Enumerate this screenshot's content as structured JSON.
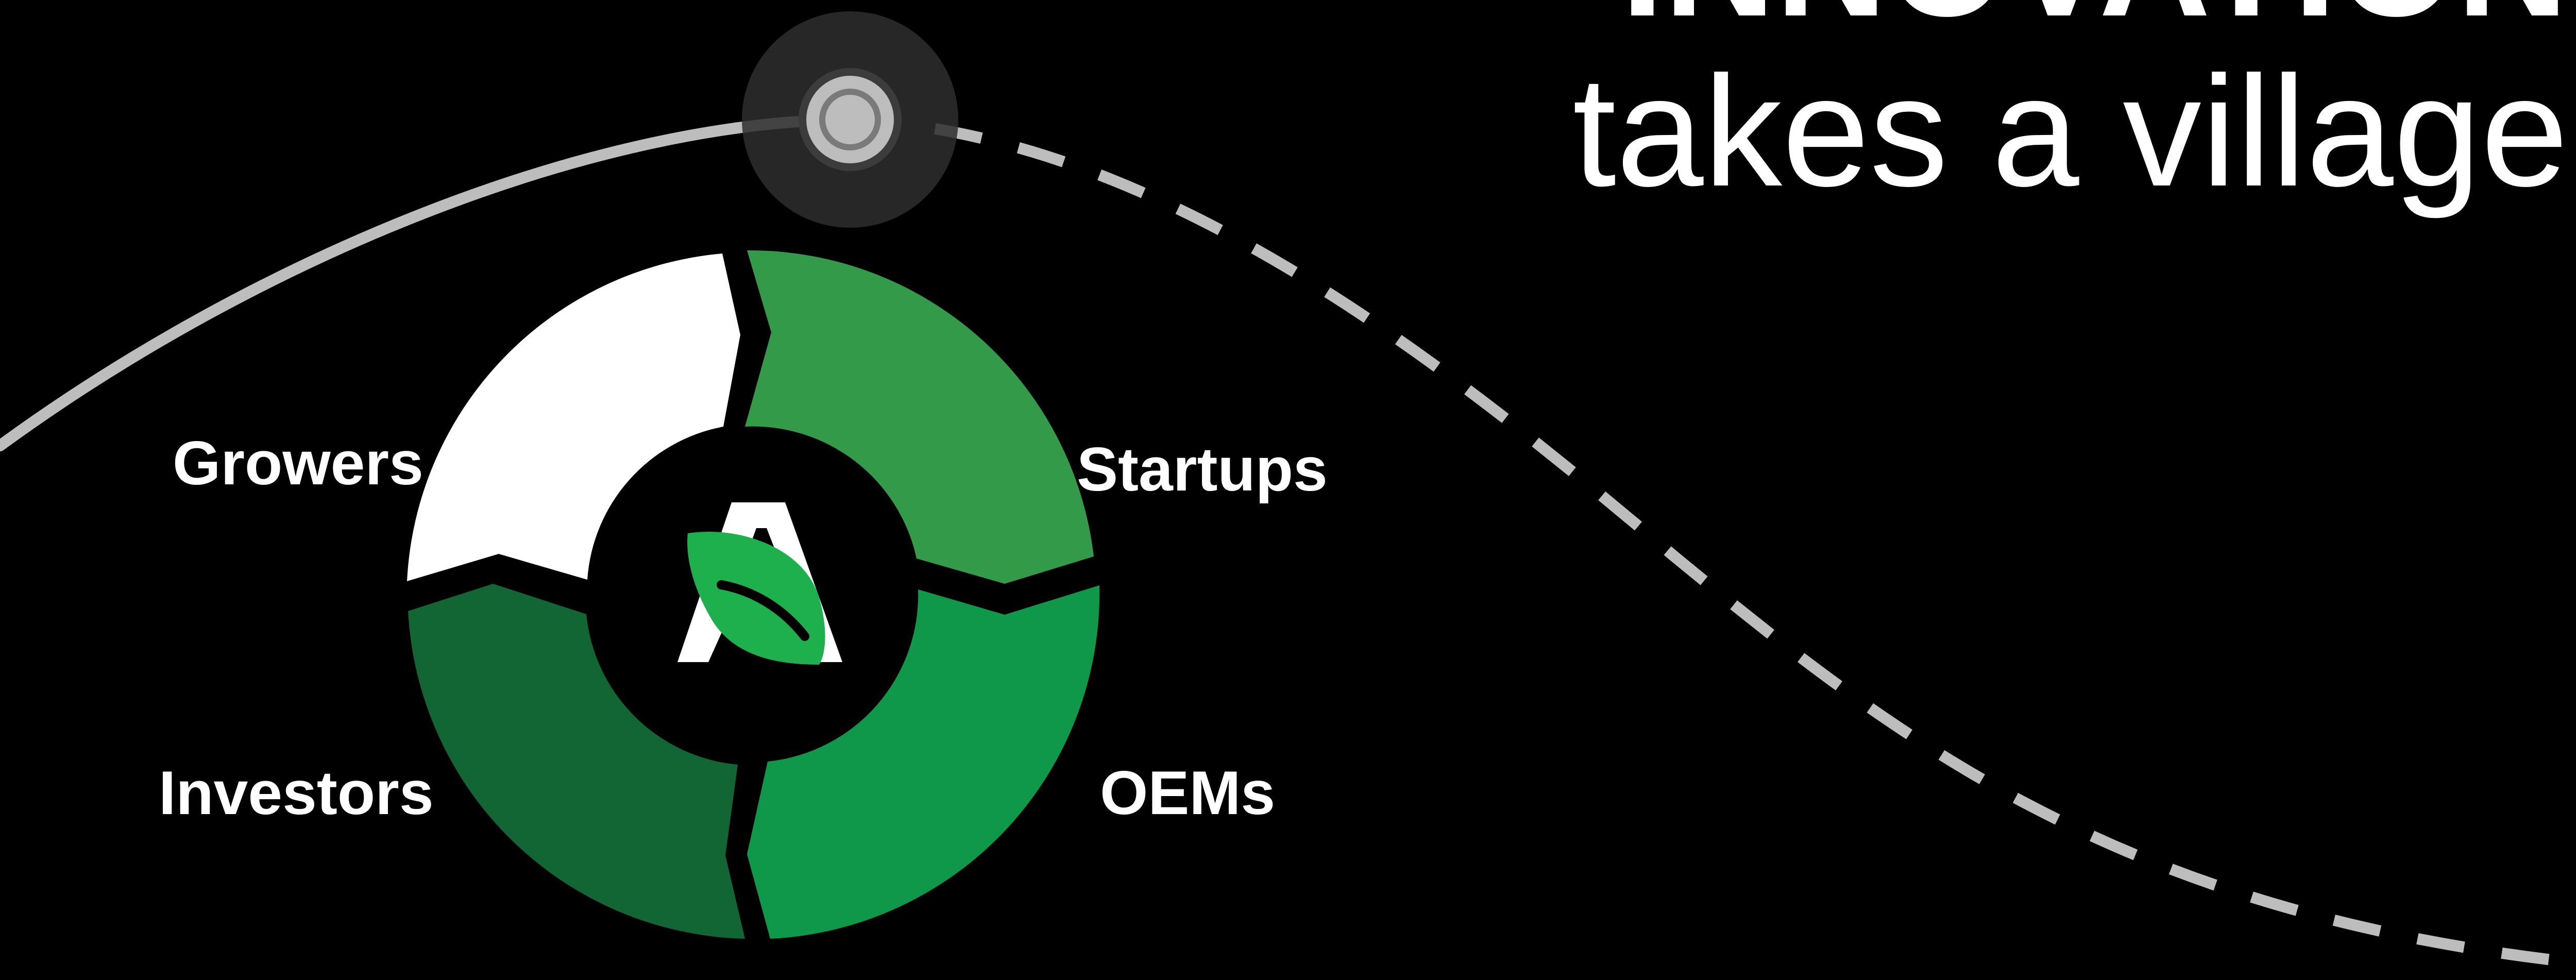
{
  "headline": {
    "main": "INNOVATION",
    "sub": "takes a village"
  },
  "wheel": {
    "segments": [
      {
        "id": "growers",
        "label": "Growers",
        "color": "#FFFFFF"
      },
      {
        "id": "startups",
        "label": "Startups",
        "color": "#339A49"
      },
      {
        "id": "oems",
        "label": "OEMs",
        "color": "#0F9849"
      },
      {
        "id": "investors",
        "label": "Investors",
        "color": "#116633"
      }
    ],
    "center_logo": {
      "letter": "A",
      "leaf_color": "#1DB04C",
      "icon": "leaf-icon"
    }
  },
  "colors": {
    "background": "#000000",
    "text": "#FFFFFF",
    "path_line": "#BDBDBD",
    "marker_halo": "#2E2E2E"
  }
}
